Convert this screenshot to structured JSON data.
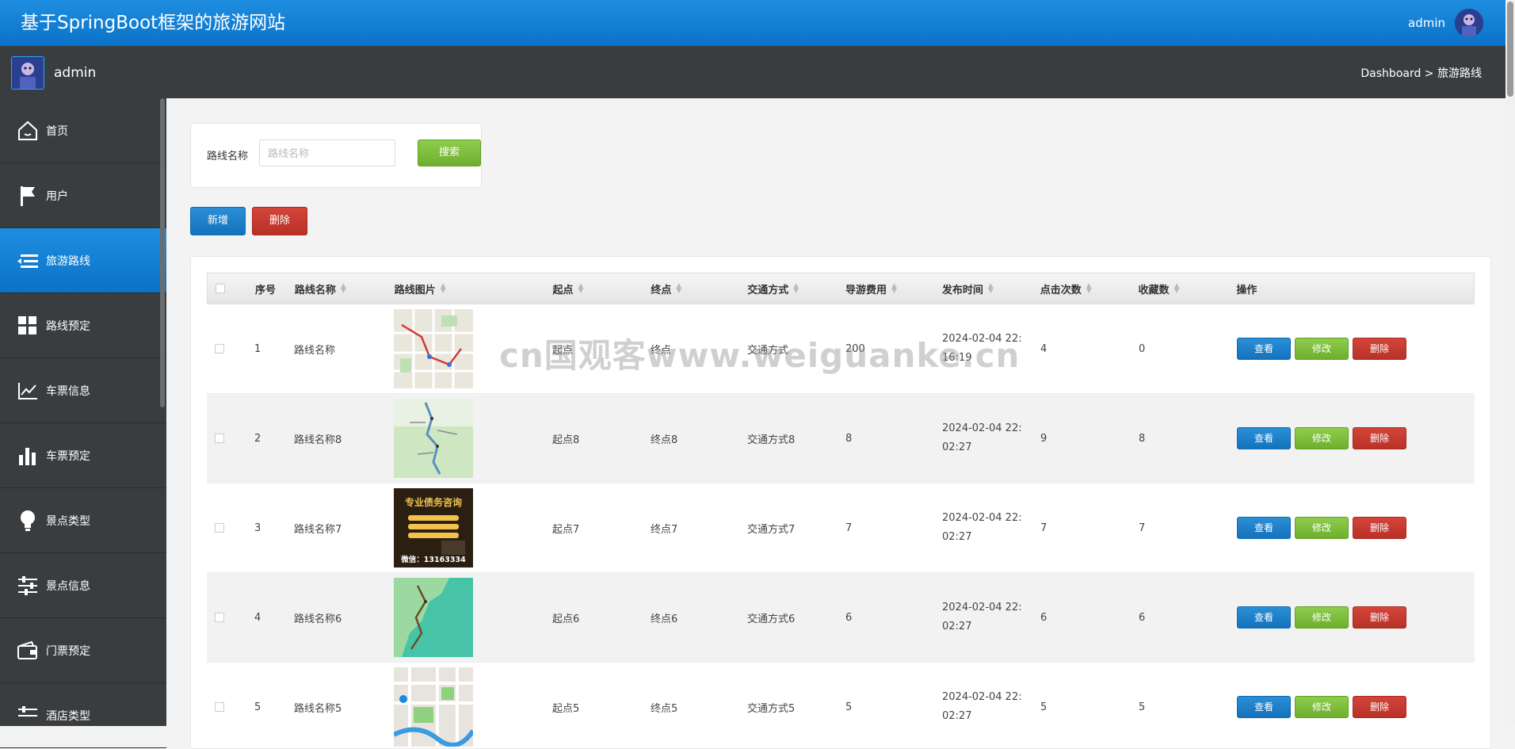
{
  "header": {
    "title": "基于SpringBoot框架的旅游网站",
    "username": "admin"
  },
  "subbar": {
    "username": "admin",
    "breadcrumb": "Dashboard > 旅游路线"
  },
  "sidebar": {
    "items": [
      {
        "label": "首页",
        "icon": "home-icon"
      },
      {
        "label": "用户",
        "icon": "flag-icon"
      },
      {
        "label": "旅游路线",
        "icon": "list-icon",
        "active": true
      },
      {
        "label": "路线预定",
        "icon": "grid-icon"
      },
      {
        "label": "车票信息",
        "icon": "chart-line-icon"
      },
      {
        "label": "车票预定",
        "icon": "bar-chart-icon"
      },
      {
        "label": "景点类型",
        "icon": "bulb-icon"
      },
      {
        "label": "景点信息",
        "icon": "sliders-icon"
      },
      {
        "label": "门票预定",
        "icon": "wallet-icon"
      },
      {
        "label": "酒店类型",
        "icon": "sliders-icon"
      }
    ]
  },
  "search": {
    "label": "路线名称",
    "placeholder": "路线名称",
    "button": "搜索"
  },
  "actions": {
    "add": "新增",
    "delete": "删除"
  },
  "table": {
    "columns": [
      "序号",
      "路线名称",
      "路线图片",
      "起点",
      "终点",
      "交通方式",
      "导游费用",
      "发布时间",
      "点击次数",
      "收藏数",
      "操作"
    ],
    "rows": [
      {
        "index": "1",
        "name": "路线名称",
        "start": "起点",
        "end": "终点",
        "transport": "交通方式",
        "fee": "200",
        "date": "2024-02-04 22:",
        "time": "16:19",
        "clicks": "4",
        "favorites": "0",
        "image": "map-city"
      },
      {
        "index": "2",
        "name": "路线名称8",
        "start": "起点8",
        "end": "终点8",
        "transport": "交通方式8",
        "fee": "8",
        "date": "2024-02-04 22:",
        "time": "02:27",
        "clicks": "9",
        "favorites": "8",
        "image": "map-park"
      },
      {
        "index": "3",
        "name": "路线名称7",
        "start": "起点7",
        "end": "终点7",
        "transport": "交通方式7",
        "fee": "7",
        "date": "2024-02-04 22:",
        "time": "02:27",
        "clicks": "7",
        "favorites": "7",
        "image": "poster"
      },
      {
        "index": "4",
        "name": "路线名称6",
        "start": "起点6",
        "end": "终点6",
        "transport": "交通方式6",
        "fee": "6",
        "date": "2024-02-04 22:",
        "time": "02:27",
        "clicks": "6",
        "favorites": "6",
        "image": "map-coast"
      },
      {
        "index": "5",
        "name": "路线名称5",
        "start": "起点5",
        "end": "终点5",
        "transport": "交通方式5",
        "fee": "5",
        "date": "2024-02-04 22:",
        "time": "02:27",
        "clicks": "5",
        "favorites": "5",
        "image": "map-grid"
      }
    ],
    "row_actions": {
      "view": "查看",
      "edit": "修改",
      "delete": "删除"
    }
  },
  "poster": {
    "line1": "专业债务咨询",
    "line2": "微信：13163334"
  },
  "watermark": "cn国观客www.weiguanke.cn",
  "colors": {
    "primary": "#0a72c7",
    "success": "#6eaf2d",
    "danger": "#b83127",
    "sidebar": "#3a3d40"
  }
}
